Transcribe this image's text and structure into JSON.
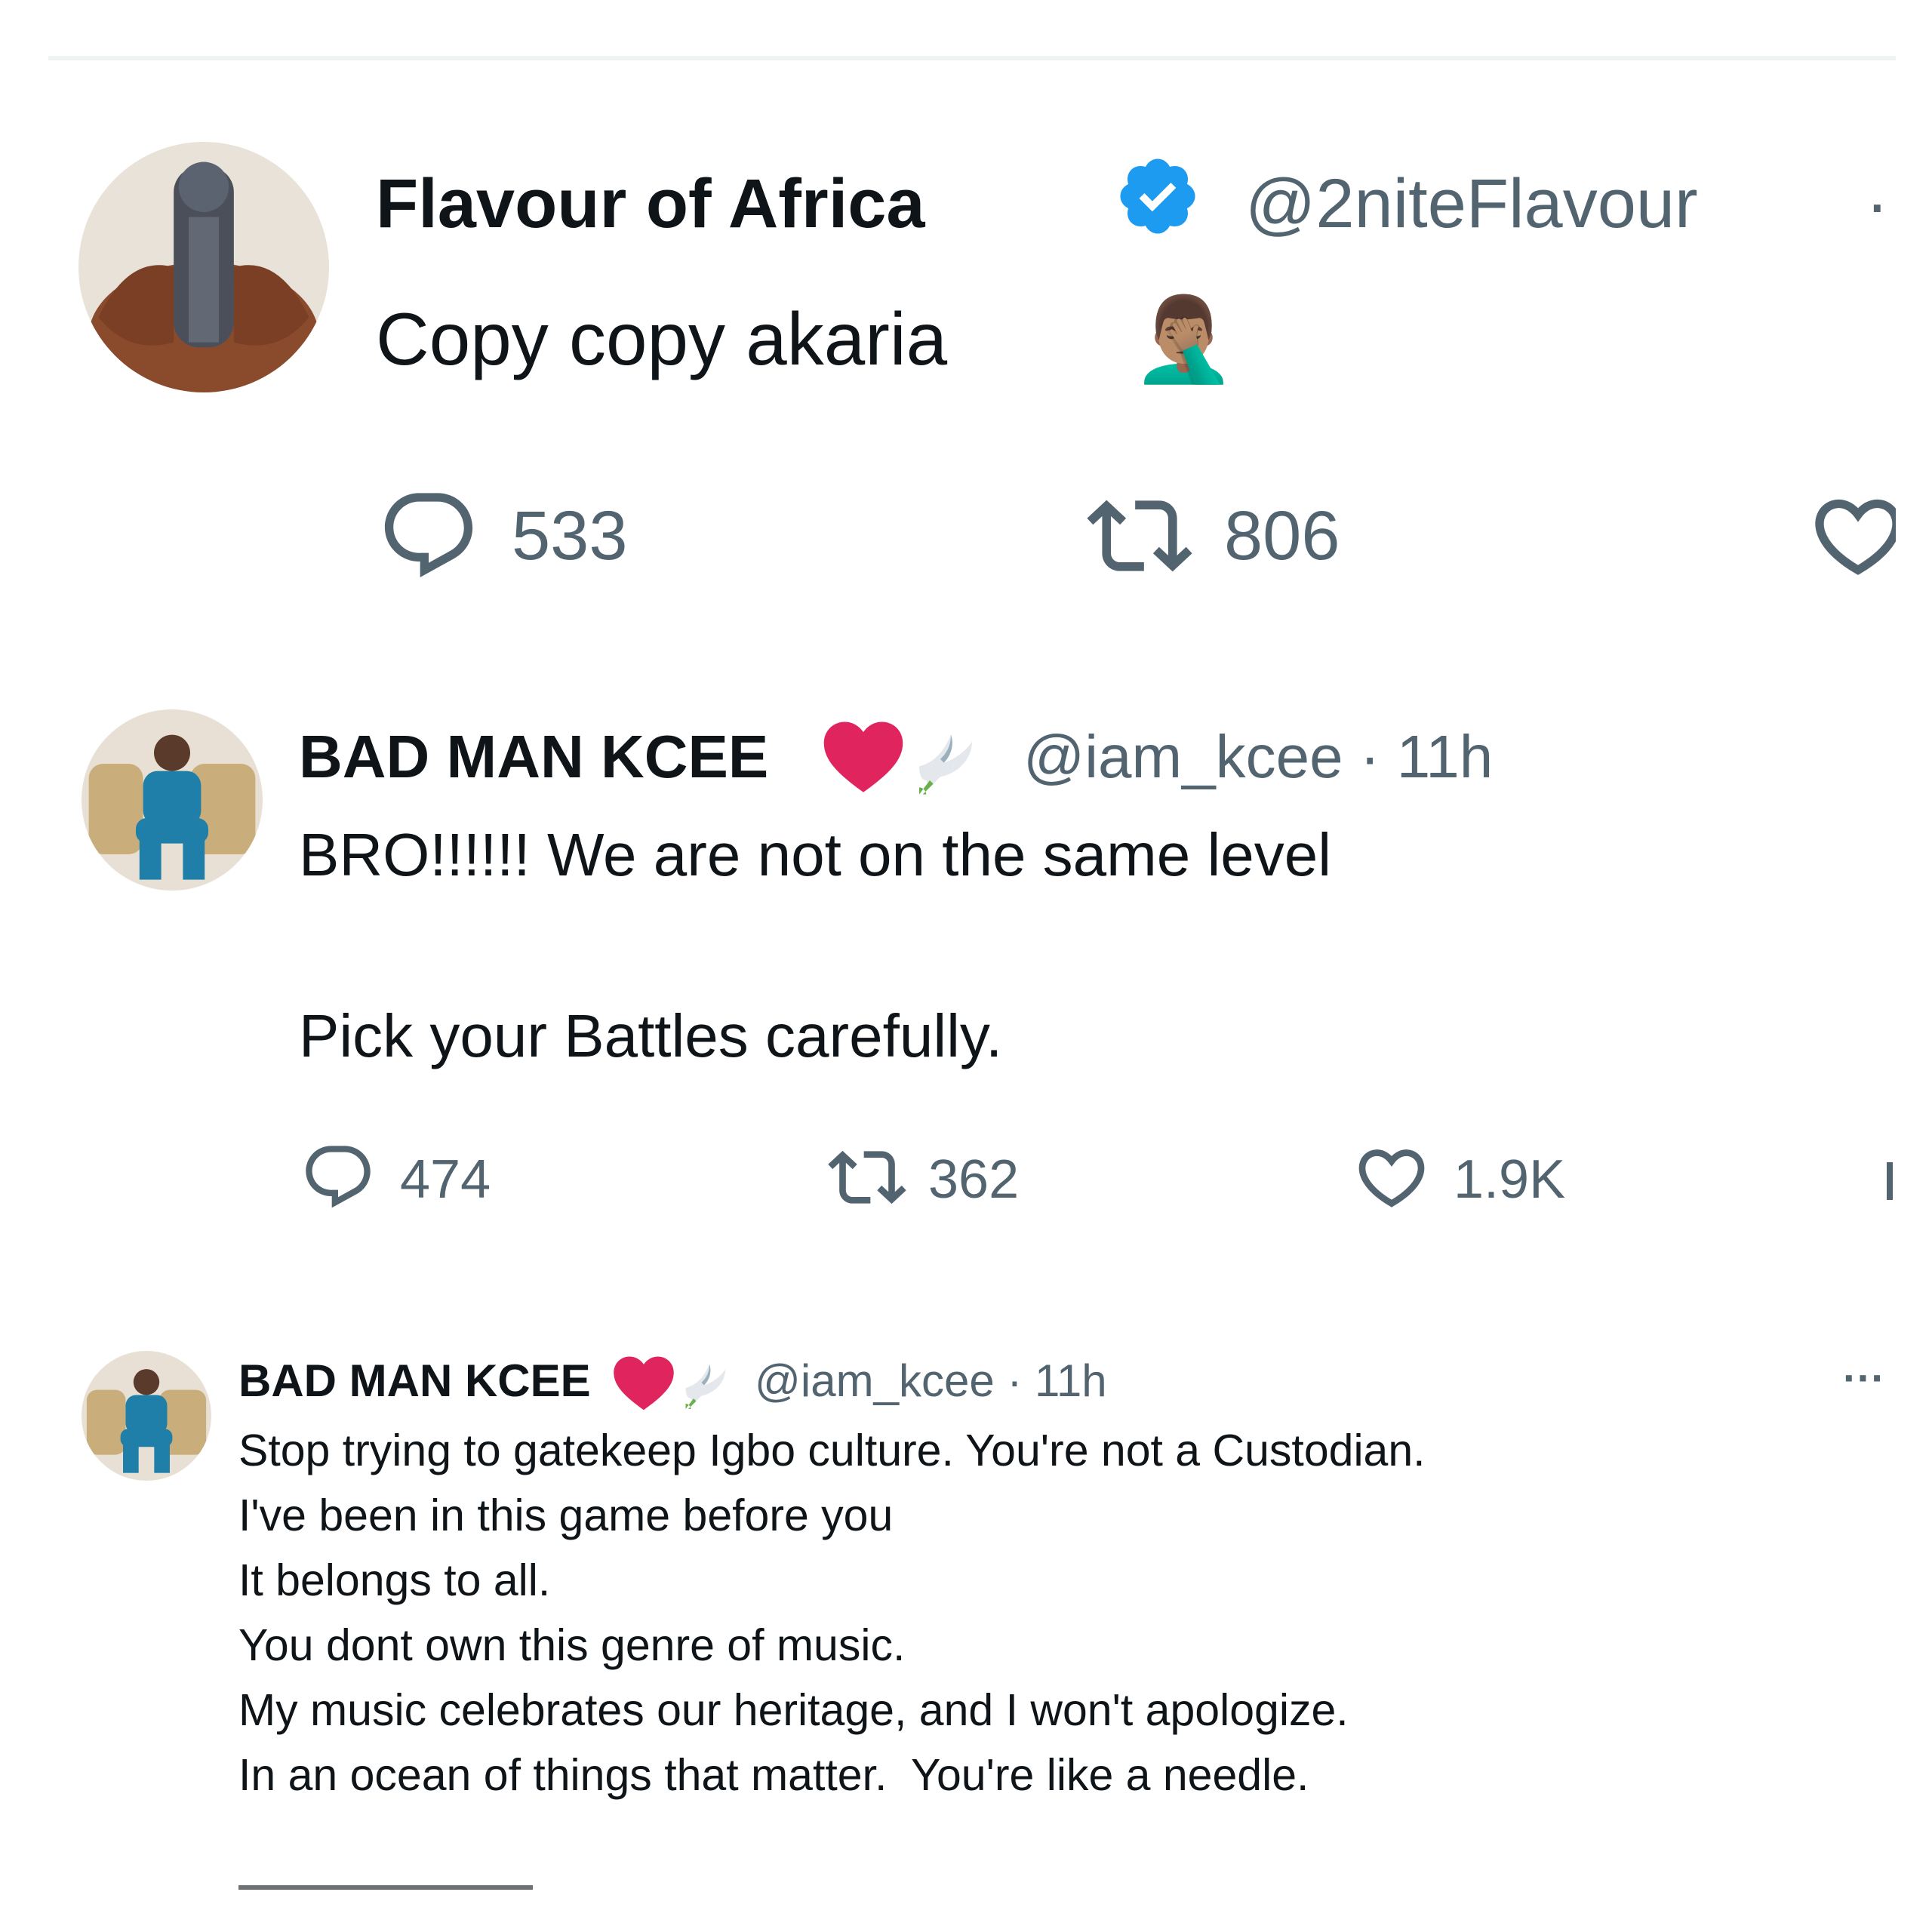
{
  "tweets": [
    {
      "display_name": "Flavour of Africa",
      "verified_icon": "verified-badge-icon",
      "handle": "@2niteFlavour",
      "separator": "·",
      "text": "Copy copy akaria",
      "emoji": "🤦🏽‍♂️",
      "replies": "533",
      "reposts": "806"
    },
    {
      "display_name": "BAD MAN KCEE",
      "decorations": [
        "heart-emoji-icon",
        "dove-emoji-icon"
      ],
      "handle_time": "@iam_kcee · 11h",
      "line1": "BRO!!!!!! We are not on the same level",
      "line2": "Pick your Battles carefully.",
      "replies": "474",
      "reposts": "362",
      "likes": "1.9K"
    },
    {
      "display_name": "BAD MAN KCEE",
      "decorations": [
        "heart-emoji-icon",
        "dove-emoji-icon"
      ],
      "handle_time": "@iam_kcee · 11h",
      "more": "···",
      "lines": [
        "Stop trying to gatekeep Igbo culture. You're not a Custodian.",
        "I've been in this game before you",
        "It belongs to all.",
        "You dont own this genre of music.",
        "My music celebrates our heritage, and I won't apologize.",
        "In an ocean of things that matter.  You're like a needle."
      ]
    }
  ],
  "colors": {
    "text": "#0f1419",
    "secondary": "#536471",
    "verified": "#1d9bf0",
    "heart": "#e0245e",
    "divider": "#eff3f4"
  }
}
